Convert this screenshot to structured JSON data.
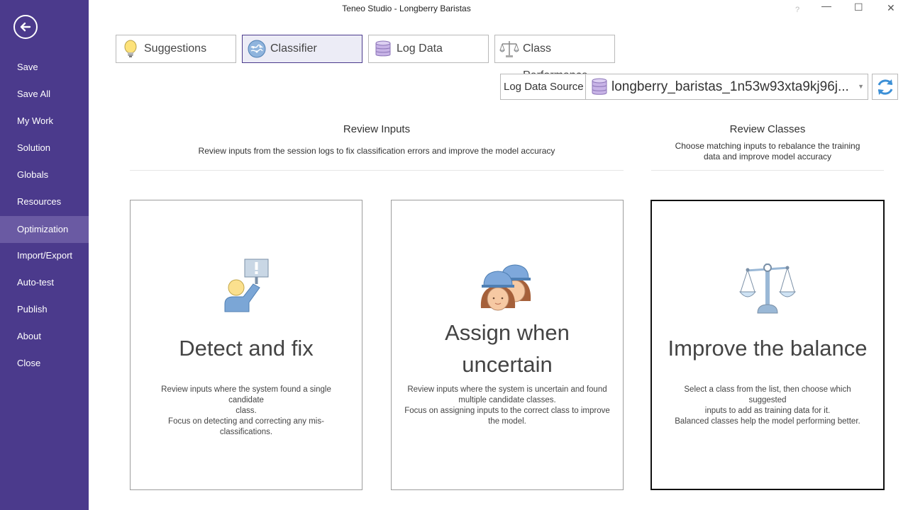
{
  "window": {
    "title": "Teneo Studio - Longberry Baristas",
    "help_glyph": "?",
    "minimize_glyph": "—",
    "maximize_glyph": "☐",
    "close_glyph": "✕"
  },
  "sidebar": {
    "items": [
      {
        "label": "Save"
      },
      {
        "label": "Save All"
      },
      {
        "label": "My Work"
      },
      {
        "label": "Solution"
      },
      {
        "label": "Globals"
      },
      {
        "label": "Resources"
      },
      {
        "label": "Optimization",
        "active": true
      },
      {
        "label": "Import/Export"
      },
      {
        "label": "Auto-test"
      },
      {
        "label": "Publish"
      },
      {
        "label": "About"
      },
      {
        "label": "Close"
      }
    ]
  },
  "tabs": [
    {
      "label": "Suggestions",
      "icon": "lightbulb-icon"
    },
    {
      "label": "Classifier",
      "icon": "brain-icon",
      "active": true
    },
    {
      "label": "Log Data",
      "icon": "database-icon"
    },
    {
      "label": "Class Performance",
      "icon": "scales-icon"
    }
  ],
  "log_data_source": {
    "label": "Log Data Source",
    "value": "longberry_baristas_1n53w93xta9kj96j..."
  },
  "sections": {
    "review_inputs": {
      "title": "Review Inputs",
      "description": "Review inputs from the session logs to fix classification errors and improve the model accuracy"
    },
    "review_classes": {
      "title": "Review Classes",
      "description_lines": [
        "Choose matching inputs to rebalance the training",
        "data and improve model accuracy"
      ]
    }
  },
  "cards": [
    {
      "title_lines": [
        "Detect and fix"
      ],
      "description_lines": [
        "Review inputs where the system found a single candidate",
        "class.",
        "Focus on detecting and correcting any mis-classifications."
      ]
    },
    {
      "title_lines": [
        "Assign when",
        "uncertain"
      ],
      "description_lines": [
        "Review inputs where the system is uncertain and found",
        "multiple candidate classes.",
        "Focus on assigning inputs to the correct class to improve",
        "the model."
      ]
    },
    {
      "title_lines": [
        "Improve the balance"
      ],
      "description_lines": [
        "Select a class from the list, then choose which suggested",
        "inputs to add as training data for it.",
        "Balanced classes help the model performing better."
      ],
      "selected": true
    }
  ],
  "colors": {
    "sidebar_bg": "#4b3a8c",
    "sidebar_active": "#6a5aa3",
    "accent_blue": "#3b8fd6"
  }
}
